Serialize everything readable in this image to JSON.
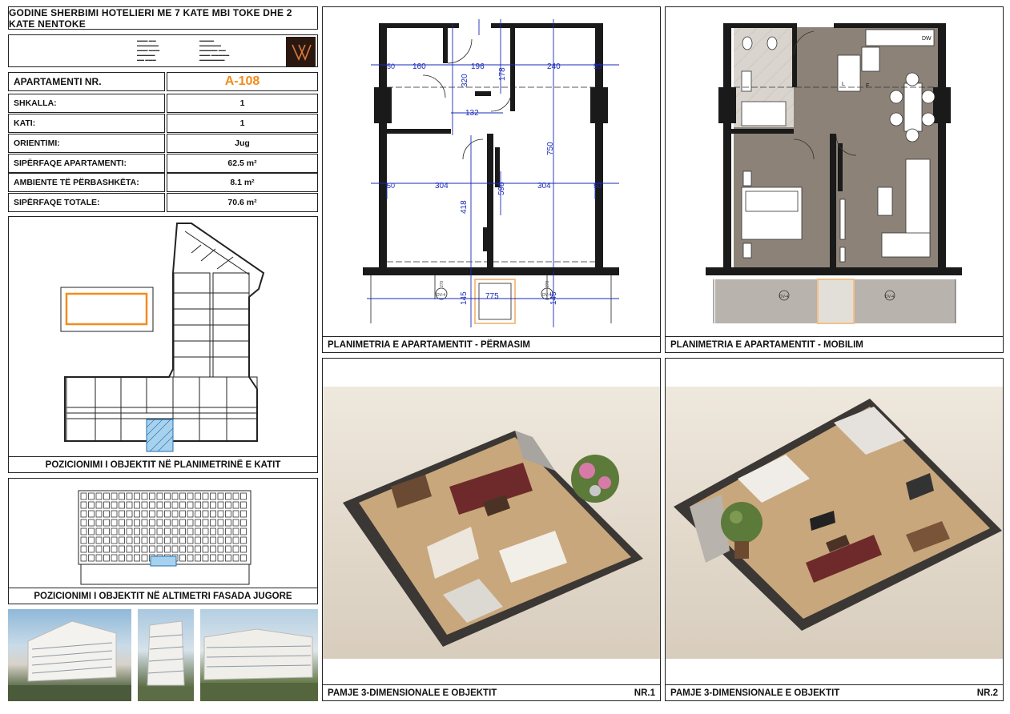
{
  "header": {
    "title": "GODINE SHERBIMI HOTELIERI ME 7 KATE MBI TOKE DHE 2 KATE NENTOKE"
  },
  "apartment": {
    "number_label": "APARTAMENTI NR.",
    "number_value": "A-108",
    "rows": [
      {
        "label": "SHKALLA:",
        "value": "1"
      },
      {
        "label": "KATI:",
        "value": "1"
      },
      {
        "label": "ORIENTIMI:",
        "value": "Jug"
      },
      {
        "label": "SIPËRFAQE APARTAMENTI:",
        "value": "62.5 m²"
      },
      {
        "label": "AMBIENTE TË PËRBASHKËTA:",
        "value": "8.1 m²"
      },
      {
        "label": "SIPËRFAQE TOTALE:",
        "value": "70.6 m²"
      }
    ]
  },
  "captions": {
    "floor_position": "POZICIONIMI I OBJEKTIT NË PLANIMETRINË E KATIT",
    "facade_position": "POZICIONIMI I OBJEKTIT NË ALTIMETRI FASADA JUGORE",
    "plan_dimensions": "PLANIMETRIA E APARTAMENTIT - PËRMASIM",
    "plan_furniture": "PLANIMETRIA E APARTAMENTIT - MOBILIM",
    "view_3d_1": "PAMJE 3-DIMENSIONALE E OBJEKTIT",
    "view_3d_1_nr": "NR.1",
    "view_3d_2": "PAMJE 3-DIMENSIONALE E OBJEKTIT",
    "view_3d_2_nr": "NR.2"
  },
  "dimensions": {
    "d160": "160",
    "d196": "196",
    "d240": "240",
    "d320": "320",
    "d178": "178",
    "d132": "132",
    "d750": "750",
    "d304a": "304",
    "d304b": "304",
    "d418": "418",
    "d598": "598",
    "d775": "775",
    "d145a": "145",
    "d145b": "145",
    "d50": "50",
    "d270": "270",
    "dv4": "DV-4"
  },
  "furniture_labels": {
    "dw": "DW",
    "l": "L",
    "f": "F"
  },
  "colors": {
    "accent": "#f28c1e",
    "dimension": "#1a2bb8",
    "floor": "#8c8278",
    "wall": "#1a1a1a"
  }
}
